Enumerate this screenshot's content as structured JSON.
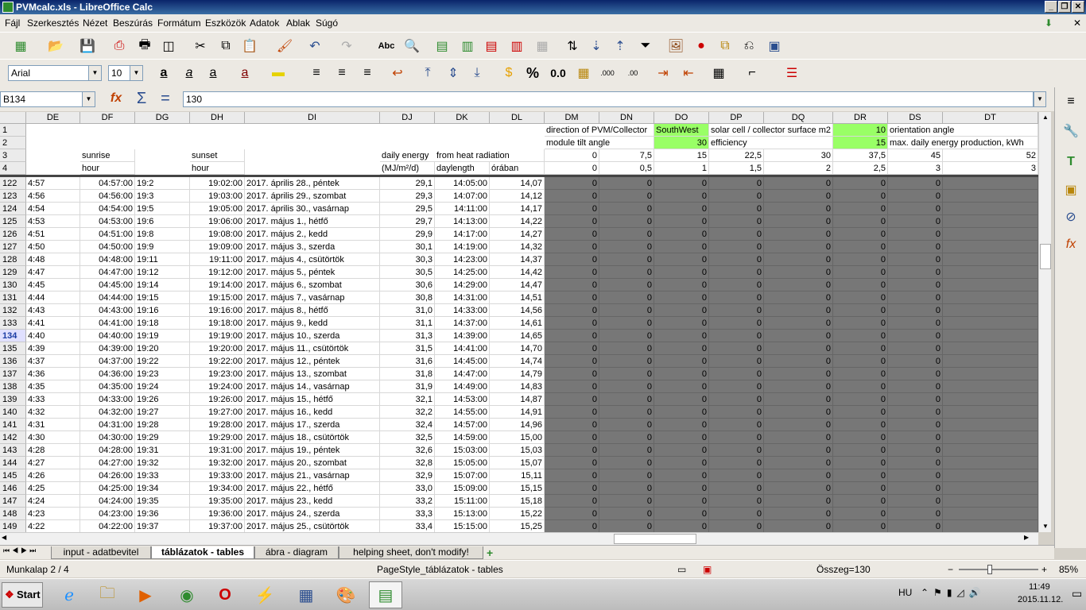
{
  "window": {
    "title": "PVMcalc.xls - LibreOffice Calc"
  },
  "menu": [
    "Fájl",
    "Szerkesztés",
    "Nézet",
    "Beszúrás",
    "Formátum",
    "Eszközök",
    "Adatok",
    "Ablak",
    "Súgó"
  ],
  "toolbar": {
    "font": "Arial",
    "size": "10"
  },
  "formula": {
    "cell_ref": "B134",
    "value": "130"
  },
  "columns": [
    "DE",
    "DF",
    "DG",
    "DH",
    "DI",
    "DJ",
    "DK",
    "DL",
    "DM",
    "DN",
    "DO",
    "DP",
    "DQ",
    "DR",
    "DS",
    "DT"
  ],
  "header_rows": {
    "r1": {
      "DM": "direction of PVM/Collector",
      "DO": "SouthWest",
      "DP": "solar cell / collector surface m2",
      "DR": "10",
      "DS": "orientation angle"
    },
    "r2": {
      "DM": "module tilt angle",
      "DO": "30",
      "DP": "efficiency",
      "DR": "15",
      "DS": "max. daily energy production, kWh"
    },
    "r3": {
      "DF": "sunrise",
      "DH": "sunset",
      "DJ": "daily energy",
      "DK": "from heat radiation",
      "DM": "0",
      "DN": "7,5",
      "DO": "15",
      "DP": "22,5",
      "DQ": "30",
      "DR": "37,5",
      "DS": "45",
      "DT": "52"
    },
    "r4": {
      "DF": "hour",
      "DH": "hour",
      "DJ": "(MJ/m²/d)",
      "DK": "daylength",
      "DL": "órában",
      "DM": "0",
      "DN": "0,5",
      "DO": "1",
      "DP": "1,5",
      "DQ": "2",
      "DR": "2,5",
      "DS": "3",
      "DT": "3"
    }
  },
  "rows": [
    {
      "n": "122",
      "de": "4:57",
      "df": "04:57:00",
      "dg": "19:2",
      "dh": "19:02:00",
      "di": "2017. április 28., péntek",
      "dj": "29,1",
      "dk": "14:05:00",
      "dl": "14,07"
    },
    {
      "n": "123",
      "de": "4:56",
      "df": "04:56:00",
      "dg": "19:3",
      "dh": "19:03:00",
      "di": "2017. április 29., szombat",
      "dj": "29,3",
      "dk": "14:07:00",
      "dl": "14,12"
    },
    {
      "n": "124",
      "de": "4:54",
      "df": "04:54:00",
      "dg": "19:5",
      "dh": "19:05:00",
      "di": "2017. április 30., vasárnap",
      "dj": "29,5",
      "dk": "14:11:00",
      "dl": "14,17"
    },
    {
      "n": "125",
      "de": "4:53",
      "df": "04:53:00",
      "dg": "19:6",
      "dh": "19:06:00",
      "di": "2017. május 1., hétfő",
      "dj": "29,7",
      "dk": "14:13:00",
      "dl": "14,22"
    },
    {
      "n": "126",
      "de": "4:51",
      "df": "04:51:00",
      "dg": "19:8",
      "dh": "19:08:00",
      "di": "2017. május 2., kedd",
      "dj": "29,9",
      "dk": "14:17:00",
      "dl": "14,27"
    },
    {
      "n": "127",
      "de": "4:50",
      "df": "04:50:00",
      "dg": "19:9",
      "dh": "19:09:00",
      "di": "2017. május 3., szerda",
      "dj": "30,1",
      "dk": "14:19:00",
      "dl": "14,32"
    },
    {
      "n": "128",
      "de": "4:48",
      "df": "04:48:00",
      "dg": "19:11",
      "dh": "19:11:00",
      "di": "2017. május 4., csütörtök",
      "dj": "30,3",
      "dk": "14:23:00",
      "dl": "14,37"
    },
    {
      "n": "129",
      "de": "4:47",
      "df": "04:47:00",
      "dg": "19:12",
      "dh": "19:12:00",
      "di": "2017. május 5., péntek",
      "dj": "30,5",
      "dk": "14:25:00",
      "dl": "14,42"
    },
    {
      "n": "130",
      "de": "4:45",
      "df": "04:45:00",
      "dg": "19:14",
      "dh": "19:14:00",
      "di": "2017. május 6., szombat",
      "dj": "30,6",
      "dk": "14:29:00",
      "dl": "14,47"
    },
    {
      "n": "131",
      "de": "4:44",
      "df": "04:44:00",
      "dg": "19:15",
      "dh": "19:15:00",
      "di": "2017. május 7., vasárnap",
      "dj": "30,8",
      "dk": "14:31:00",
      "dl": "14,51"
    },
    {
      "n": "132",
      "de": "4:43",
      "df": "04:43:00",
      "dg": "19:16",
      "dh": "19:16:00",
      "di": "2017. május 8., hétfő",
      "dj": "31,0",
      "dk": "14:33:00",
      "dl": "14,56"
    },
    {
      "n": "133",
      "de": "4:41",
      "df": "04:41:00",
      "dg": "19:18",
      "dh": "19:18:00",
      "di": "2017. május 9., kedd",
      "dj": "31,1",
      "dk": "14:37:00",
      "dl": "14,61"
    },
    {
      "n": "134",
      "de": "4:40",
      "df": "04:40:00",
      "dg": "19:19",
      "dh": "19:19:00",
      "di": "2017. május 10., szerda",
      "dj": "31,3",
      "dk": "14:39:00",
      "dl": "14,65"
    },
    {
      "n": "135",
      "de": "4:39",
      "df": "04:39:00",
      "dg": "19:20",
      "dh": "19:20:00",
      "di": "2017. május 11., csütörtök",
      "dj": "31,5",
      "dk": "14:41:00",
      "dl": "14,70"
    },
    {
      "n": "136",
      "de": "4:37",
      "df": "04:37:00",
      "dg": "19:22",
      "dh": "19:22:00",
      "di": "2017. május 12., péntek",
      "dj": "31,6",
      "dk": "14:45:00",
      "dl": "14,74"
    },
    {
      "n": "137",
      "de": "4:36",
      "df": "04:36:00",
      "dg": "19:23",
      "dh": "19:23:00",
      "di": "2017. május 13., szombat",
      "dj": "31,8",
      "dk": "14:47:00",
      "dl": "14,79"
    },
    {
      "n": "138",
      "de": "4:35",
      "df": "04:35:00",
      "dg": "19:24",
      "dh": "19:24:00",
      "di": "2017. május 14., vasárnap",
      "dj": "31,9",
      "dk": "14:49:00",
      "dl": "14,83"
    },
    {
      "n": "139",
      "de": "4:33",
      "df": "04:33:00",
      "dg": "19:26",
      "dh": "19:26:00",
      "di": "2017. május 15., hétfő",
      "dj": "32,1",
      "dk": "14:53:00",
      "dl": "14,87"
    },
    {
      "n": "140",
      "de": "4:32",
      "df": "04:32:00",
      "dg": "19:27",
      "dh": "19:27:00",
      "di": "2017. május 16., kedd",
      "dj": "32,2",
      "dk": "14:55:00",
      "dl": "14,91"
    },
    {
      "n": "141",
      "de": "4:31",
      "df": "04:31:00",
      "dg": "19:28",
      "dh": "19:28:00",
      "di": "2017. május 17., szerda",
      "dj": "32,4",
      "dk": "14:57:00",
      "dl": "14,96"
    },
    {
      "n": "142",
      "de": "4:30",
      "df": "04:30:00",
      "dg": "19:29",
      "dh": "19:29:00",
      "di": "2017. május 18., csütörtök",
      "dj": "32,5",
      "dk": "14:59:00",
      "dl": "15,00"
    },
    {
      "n": "143",
      "de": "4:28",
      "df": "04:28:00",
      "dg": "19:31",
      "dh": "19:31:00",
      "di": "2017. május 19., péntek",
      "dj": "32,6",
      "dk": "15:03:00",
      "dl": "15,03"
    },
    {
      "n": "144",
      "de": "4:27",
      "df": "04:27:00",
      "dg": "19:32",
      "dh": "19:32:00",
      "di": "2017. május 20., szombat",
      "dj": "32,8",
      "dk": "15:05:00",
      "dl": "15,07"
    },
    {
      "n": "145",
      "de": "4:26",
      "df": "04:26:00",
      "dg": "19:33",
      "dh": "19:33:00",
      "di": "2017. május 21., vasárnap",
      "dj": "32,9",
      "dk": "15:07:00",
      "dl": "15,11"
    },
    {
      "n": "146",
      "de": "4:25",
      "df": "04:25:00",
      "dg": "19:34",
      "dh": "19:34:00",
      "di": "2017. május 22., hétfő",
      "dj": "33,0",
      "dk": "15:09:00",
      "dl": "15,15"
    },
    {
      "n": "147",
      "de": "4:24",
      "df": "04:24:00",
      "dg": "19:35",
      "dh": "19:35:00",
      "di": "2017. május 23., kedd",
      "dj": "33,2",
      "dk": "15:11:00",
      "dl": "15,18"
    },
    {
      "n": "148",
      "de": "4:23",
      "df": "04:23:00",
      "dg": "19:36",
      "dh": "19:36:00",
      "di": "2017. május 24., szerda",
      "dj": "33,3",
      "dk": "15:13:00",
      "dl": "15,22"
    },
    {
      "n": "149",
      "de": "4:22",
      "df": "04:22:00",
      "dg": "19:37",
      "dh": "19:37:00",
      "di": "2017. május 25., csütörtök",
      "dj": "33,4",
      "dk": "15:15:00",
      "dl": "15,25"
    }
  ],
  "zero": "0",
  "selected_row": "134",
  "tabs": [
    "input - adatbevitel",
    "táblázatok - tables",
    "ábra - diagram",
    "helping sheet, don't modify!"
  ],
  "active_tab": 1,
  "status": {
    "sheet": "Munkalap 2 / 4",
    "page_style": "PageStyle_táblázatok - tables",
    "sum": "Összeg=130",
    "zoom": "85%"
  },
  "taskbar": {
    "start": "Start",
    "lang": "HU",
    "time": "11:49",
    "date": "2015.11.12."
  },
  "colors": {
    "green": "#99ff66",
    "grey": "#777777",
    "titlebar": "#0a246a"
  }
}
